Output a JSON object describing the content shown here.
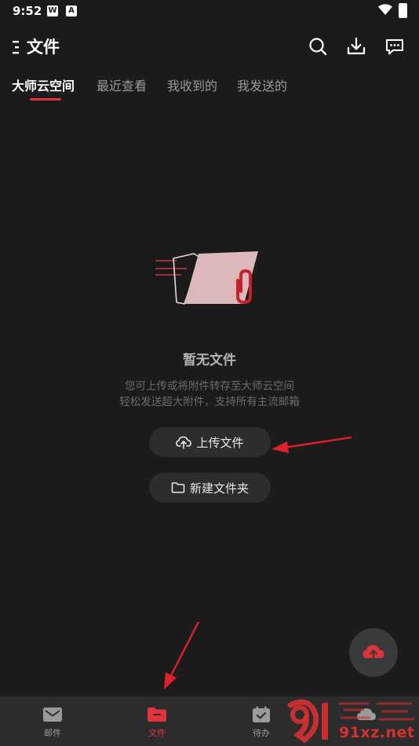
{
  "status_bar": {
    "time": "9:52",
    "badges": [
      "W",
      "A"
    ]
  },
  "header": {
    "title": "文件",
    "icons": [
      "menu-icon",
      "search-icon",
      "download-icon",
      "message-icon"
    ]
  },
  "tabs": [
    {
      "label": "大师云空间",
      "active": true
    },
    {
      "label": "最近查看",
      "active": false
    },
    {
      "label": "我收到的",
      "active": false
    },
    {
      "label": "我发送的",
      "active": false
    }
  ],
  "empty_state": {
    "title": "暂无文件",
    "desc_line1": "您可上传或将附件转存至大师云空间",
    "desc_line2": "轻松发送超大附件，支持所有主流邮箱"
  },
  "actions": {
    "upload_label": "上传文件",
    "new_folder_label": "新建文件夹"
  },
  "bottom_nav": [
    {
      "label": "邮件",
      "icon": "mail-icon",
      "active": false
    },
    {
      "label": "文件",
      "icon": "folder-icon",
      "active": true
    },
    {
      "label": "待办",
      "icon": "todo-icon",
      "active": false
    },
    {
      "label": "",
      "icon": "cloud-icon",
      "active": false
    }
  ],
  "watermark": {
    "text": "91xz.net"
  },
  "colors": {
    "background": "#1b1b1b",
    "accent": "#e0333b",
    "pill": "#2d2d2d",
    "nav_bg": "#2c2c2c"
  }
}
